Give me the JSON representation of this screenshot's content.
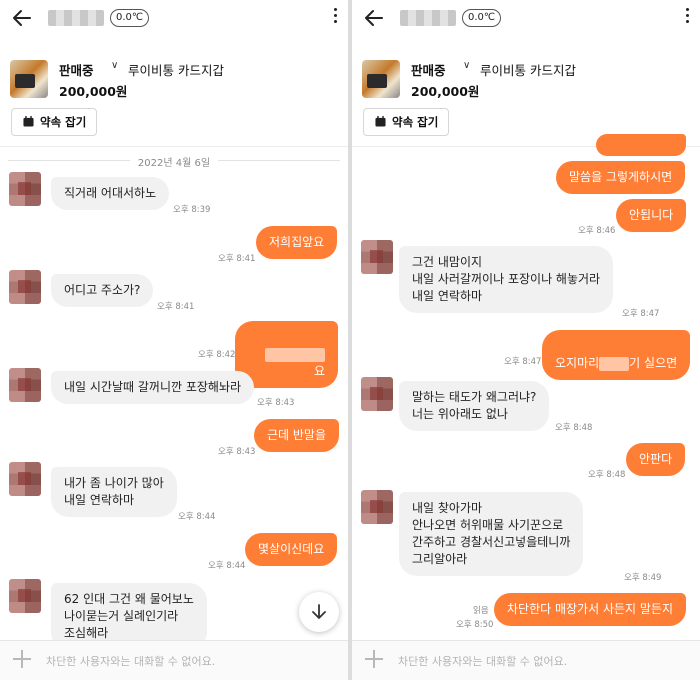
{
  "header": {
    "temperature": "0.0℃"
  },
  "product": {
    "status": "판매중",
    "title": "루이비통 카드지갑",
    "price": "200,000원",
    "appointment_label": "약속 잡기"
  },
  "chat_left": {
    "date": "2022년 4월 6일",
    "messages": [
      {
        "text": "직거래 어대서하노",
        "time": "오후 8:39"
      },
      {
        "text": "저희집앞요",
        "time": "오후 8:41"
      },
      {
        "text": "어디고 주소가?",
        "time": "오후 8:41"
      },
      {
        "text": "요",
        "time": "오후 8:42"
      },
      {
        "text": "내일 시간날때 갈꺼니깐 포장해놔라",
        "time": "오후 8:43"
      },
      {
        "text": "근데 반말을",
        "time": "오후 8:43"
      },
      {
        "text": "내가 좀 나이가 많아\n내일 연락하마",
        "time": "오후 8:44"
      },
      {
        "text": "몇살이신데요",
        "time": "오후 8:44"
      },
      {
        "text": "62 인대 그건 왜 물어보노\n나이묻는거 실례인기라\n조심해라",
        "time": ""
      }
    ]
  },
  "chat_right": {
    "messages": [
      {
        "text": "말씀을 그렇게하시면",
        "time": ""
      },
      {
        "text": "안됩니다",
        "time": "오후 8:46"
      },
      {
        "text": "그건 내맘이지\n 내일 사러갈꺼이나 포장이나 해놓거라\n내일 연락하마",
        "time": "오후 8:47"
      },
      {
        "text_before": "오지마리",
        "text_after": "기 실으면",
        "time": "오후 8:47"
      },
      {
        "text": "말하는 태도가 왜그러냐?\n너는 위아래도 없나",
        "time": "오후 8:48"
      },
      {
        "text": "안판다",
        "time": "오후 8:48"
      },
      {
        "text": "내일 찾아가마\n안나오면 허위매물 사기꾼으로\n간주하고 경찰서신고넣을테니까\n그리알아라",
        "time": "오후 8:49"
      },
      {
        "text": "차단한다 매장가서 사든지 말든지",
        "time": "오후 8:50",
        "read": "읽음"
      }
    ]
  },
  "input_bar": {
    "placeholder": "차단한 사용자와는 대화할 수 없어요."
  },
  "colors": {
    "accent": "#ff7e36",
    "incoming": "#f1f1f1"
  }
}
